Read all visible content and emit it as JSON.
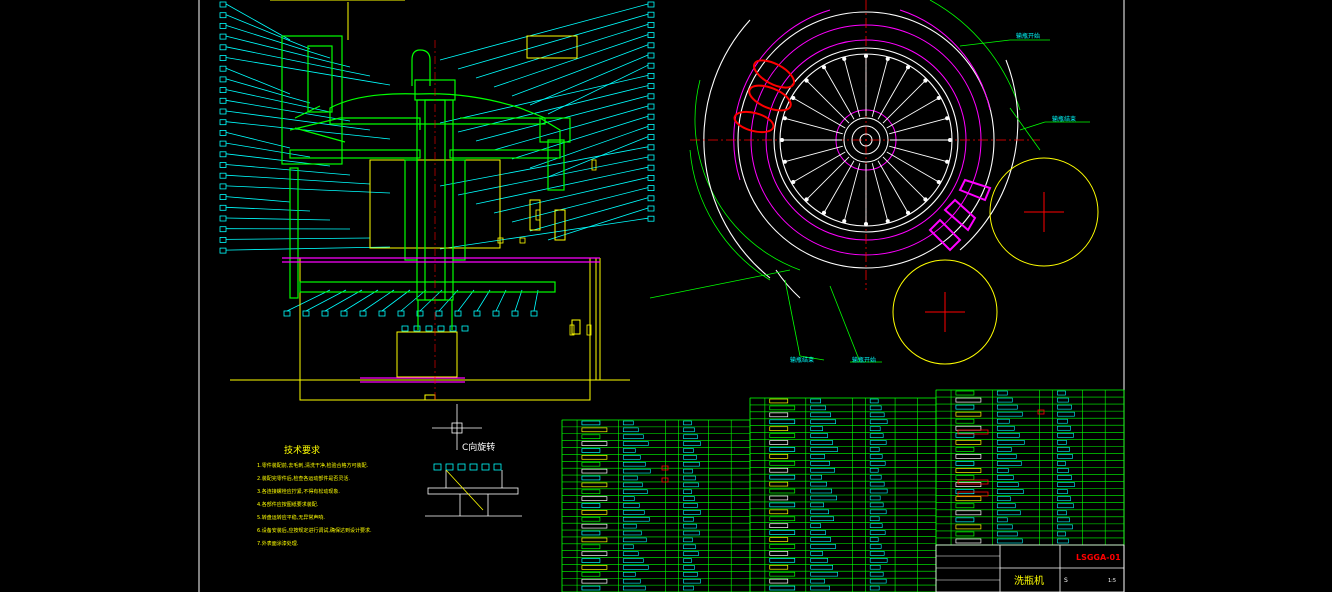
{
  "drawing": {
    "section_label": "C向旋转",
    "tech_title": "技术要求",
    "tech_notes": [
      "1.零件装配前,去毛刺,清洗干净,检验合格方可装配.",
      "2.装配完零件后,检查各运动部件是否灵活.",
      "3.各连接螺栓应拧紧,不得有松动现象.",
      "4.各部件应按图纸要求装配.",
      "5.转盘运转应平稳,无异常声响.",
      "6.设备安装后,应按规定进行调试,确保达到设计要求.",
      "7.外表面涂漆处理."
    ],
    "callouts": {
      "feed_start": "输瓶开始",
      "feed_end": "输瓶结束",
      "out_end": "输瓶结束",
      "out_start": "输瓶开始"
    },
    "title_block": {
      "drawing_no": "LSGGA-01",
      "name": "洗瓶机",
      "scale": "1:5",
      "sheet": "S"
    }
  },
  "colors": {
    "frame": "#ffffff",
    "green": "#00ff00",
    "yellow": "#ffff00",
    "cyan": "#00ffff",
    "magenta": "#ff00ff",
    "red": "#ff0000",
    "white": "#ffffff"
  }
}
